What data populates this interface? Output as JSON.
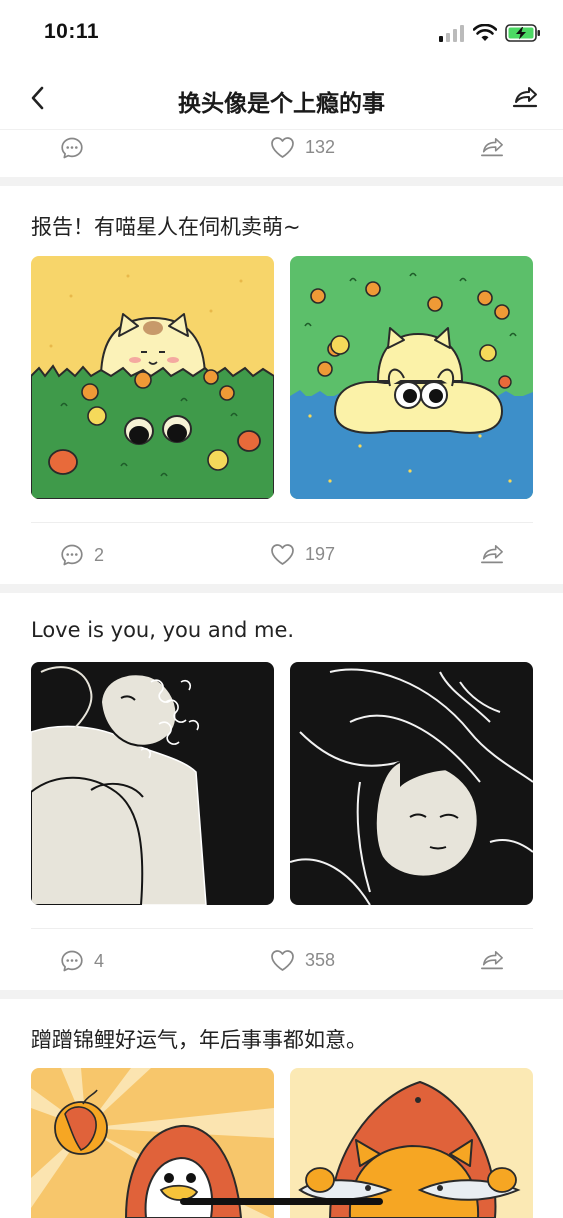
{
  "status_bar": {
    "time": "10:11"
  },
  "nav": {
    "title": "换头像是个上瘾的事"
  },
  "top_actions": {
    "likes": "132"
  },
  "posts": [
    {
      "title": "报告！有喵星人在伺机卖萌~",
      "comments": "2",
      "likes": "197"
    },
    {
      "title": "Love is you, you and me.",
      "comments": "4",
      "likes": "358"
    },
    {
      "title": "蹭蹭锦鲤好运气，年后事事都如意。"
    }
  ],
  "icons": {
    "back": "chevron-left-icon",
    "share": "share-icon",
    "comment": "comment-icon",
    "like": "heart-icon",
    "signal": "signal-icon",
    "wifi": "wifi-icon",
    "battery": "battery-charging-icon"
  },
  "colors": {
    "battery_green": "#4cd964",
    "cat_bg_yellow": "#f7d56a",
    "cat_bg_green": "#5cbf6a",
    "water_blue": "#3d8fc9",
    "dark_bg": "#141414",
    "koi_orange": "#e0623a"
  }
}
